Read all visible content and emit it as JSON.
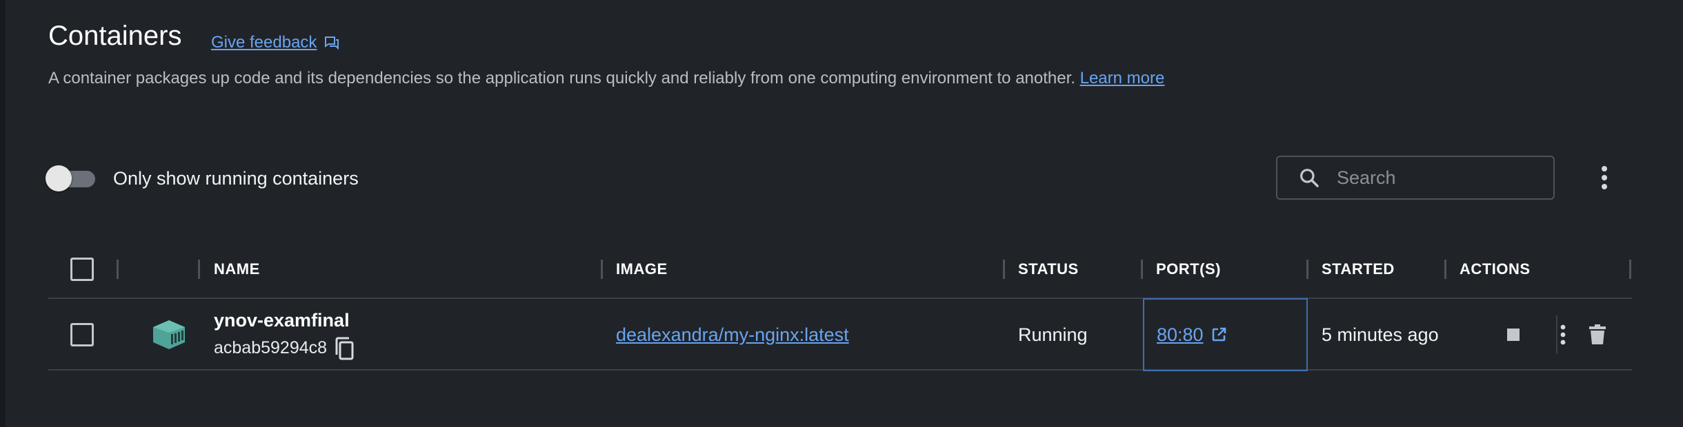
{
  "header": {
    "title": "Containers",
    "feedback_label": "Give feedback",
    "description": "A container packages up code and its dependencies so the application runs quickly and reliably from one computing environment to another.",
    "learn_more_label": "Learn more"
  },
  "filters": {
    "only_running_label": "Only show running containers",
    "only_running_enabled": false,
    "search_placeholder": "Search"
  },
  "table": {
    "columns": {
      "name": "NAME",
      "image": "IMAGE",
      "status": "STATUS",
      "ports": "PORT(S)",
      "started": "STARTED",
      "actions": "ACTIONS"
    },
    "rows": [
      {
        "name": "ynov-examfinal",
        "id": "acbab59294c8",
        "image": "dealexandra/my-nginx:latest",
        "status": "Running",
        "port": "80:80",
        "started": "5 minutes ago"
      }
    ]
  },
  "colors": {
    "background": "#202429",
    "accent_link": "#6aa4ee",
    "container_icon": "#4fa397",
    "focus_border": "#3d6fae"
  },
  "icons": {
    "feedback": "feedback-icon",
    "search": "search-icon",
    "more": "more-vertical-icon",
    "container": "container-icon",
    "copy": "copy-icon",
    "external": "open-external-icon",
    "stop": "stop-icon",
    "delete": "trash-icon"
  }
}
